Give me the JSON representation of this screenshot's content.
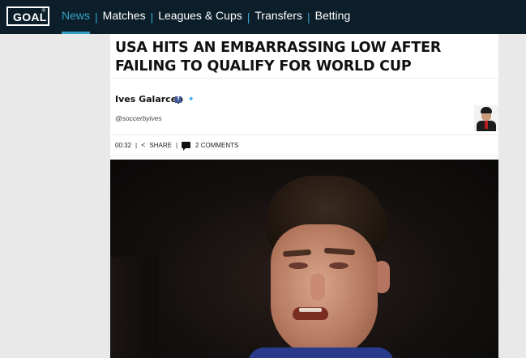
{
  "brand": {
    "logo_text": "GOAL",
    "logo_mark": "®"
  },
  "nav": {
    "items": [
      {
        "label": "News",
        "active": true
      },
      {
        "label": "Matches",
        "active": false
      },
      {
        "label": "Leagues & Cups",
        "active": false
      },
      {
        "label": "Transfers",
        "active": false
      },
      {
        "label": "Betting",
        "active": false
      }
    ],
    "separator": "|"
  },
  "article": {
    "headline": "USA HITS AN EMBARRASSING LOW AFTER FAILING TO QUALIFY FOR WORLD CUP",
    "author": "Ives Galarcep",
    "author_handle": "@soccerbyives",
    "social_icons": [
      "facebook-icon",
      "twitter-icon"
    ],
    "meta": {
      "time": "00:32",
      "share_label": "SHARE",
      "comments_label": "2 COMMENTS"
    }
  },
  "colors": {
    "topbar": "#0c1e2a",
    "accent": "#34a0c6",
    "page_bg": "#e9e9e9",
    "facebook": "#3b5998",
    "twitter": "#1da1f2"
  }
}
